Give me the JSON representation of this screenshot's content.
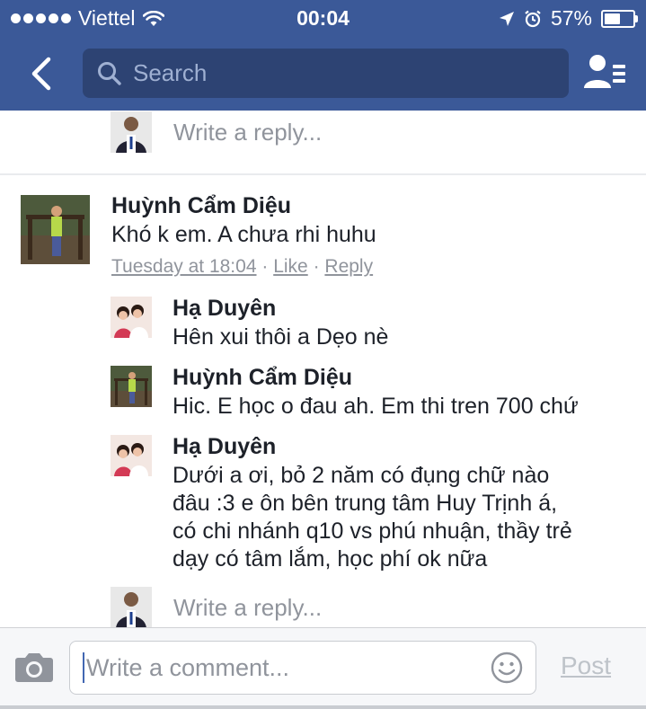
{
  "status_bar": {
    "carrier": "Viettel",
    "time": "00:04",
    "battery": "57%",
    "battery_level": 0.57
  },
  "nav": {
    "search_placeholder": "Search"
  },
  "reply_prompt": "Write a reply...",
  "comment": {
    "author": "Huỳnh Cẩm Diệu",
    "text": "Khó k em. A chưa rhi huhu",
    "time": "Tuesday at 18:04",
    "like": "Like",
    "reply": "Reply",
    "separator": "·"
  },
  "replies": [
    {
      "author": "Hạ Duyên",
      "lines": [
        "Hên xui thôi a Dẹo nè"
      ]
    },
    {
      "author": "Huỳnh Cẩm Diệu",
      "lines": [
        "Hic. E học o đau ah. Em thi tren 700 chứ"
      ]
    },
    {
      "author": "Hạ Duyên",
      "lines": [
        "Dưới a ơi, bỏ 2 năm có đụng chữ nào",
        "đâu :3 e ôn bên trung tâm Huy Trịnh á,",
        "có chi nhánh q10 vs phú nhuận, thầy trẻ",
        "dạy có tâm lắm, học phí ok nữa"
      ]
    }
  ],
  "composer": {
    "placeholder": "Write a comment...",
    "post_label": "Post"
  },
  "colors": {
    "header": "#3b5998",
    "search_bg": "#2d4373",
    "muted": "#90949c",
    "post_disabled": "#bec3c9"
  }
}
